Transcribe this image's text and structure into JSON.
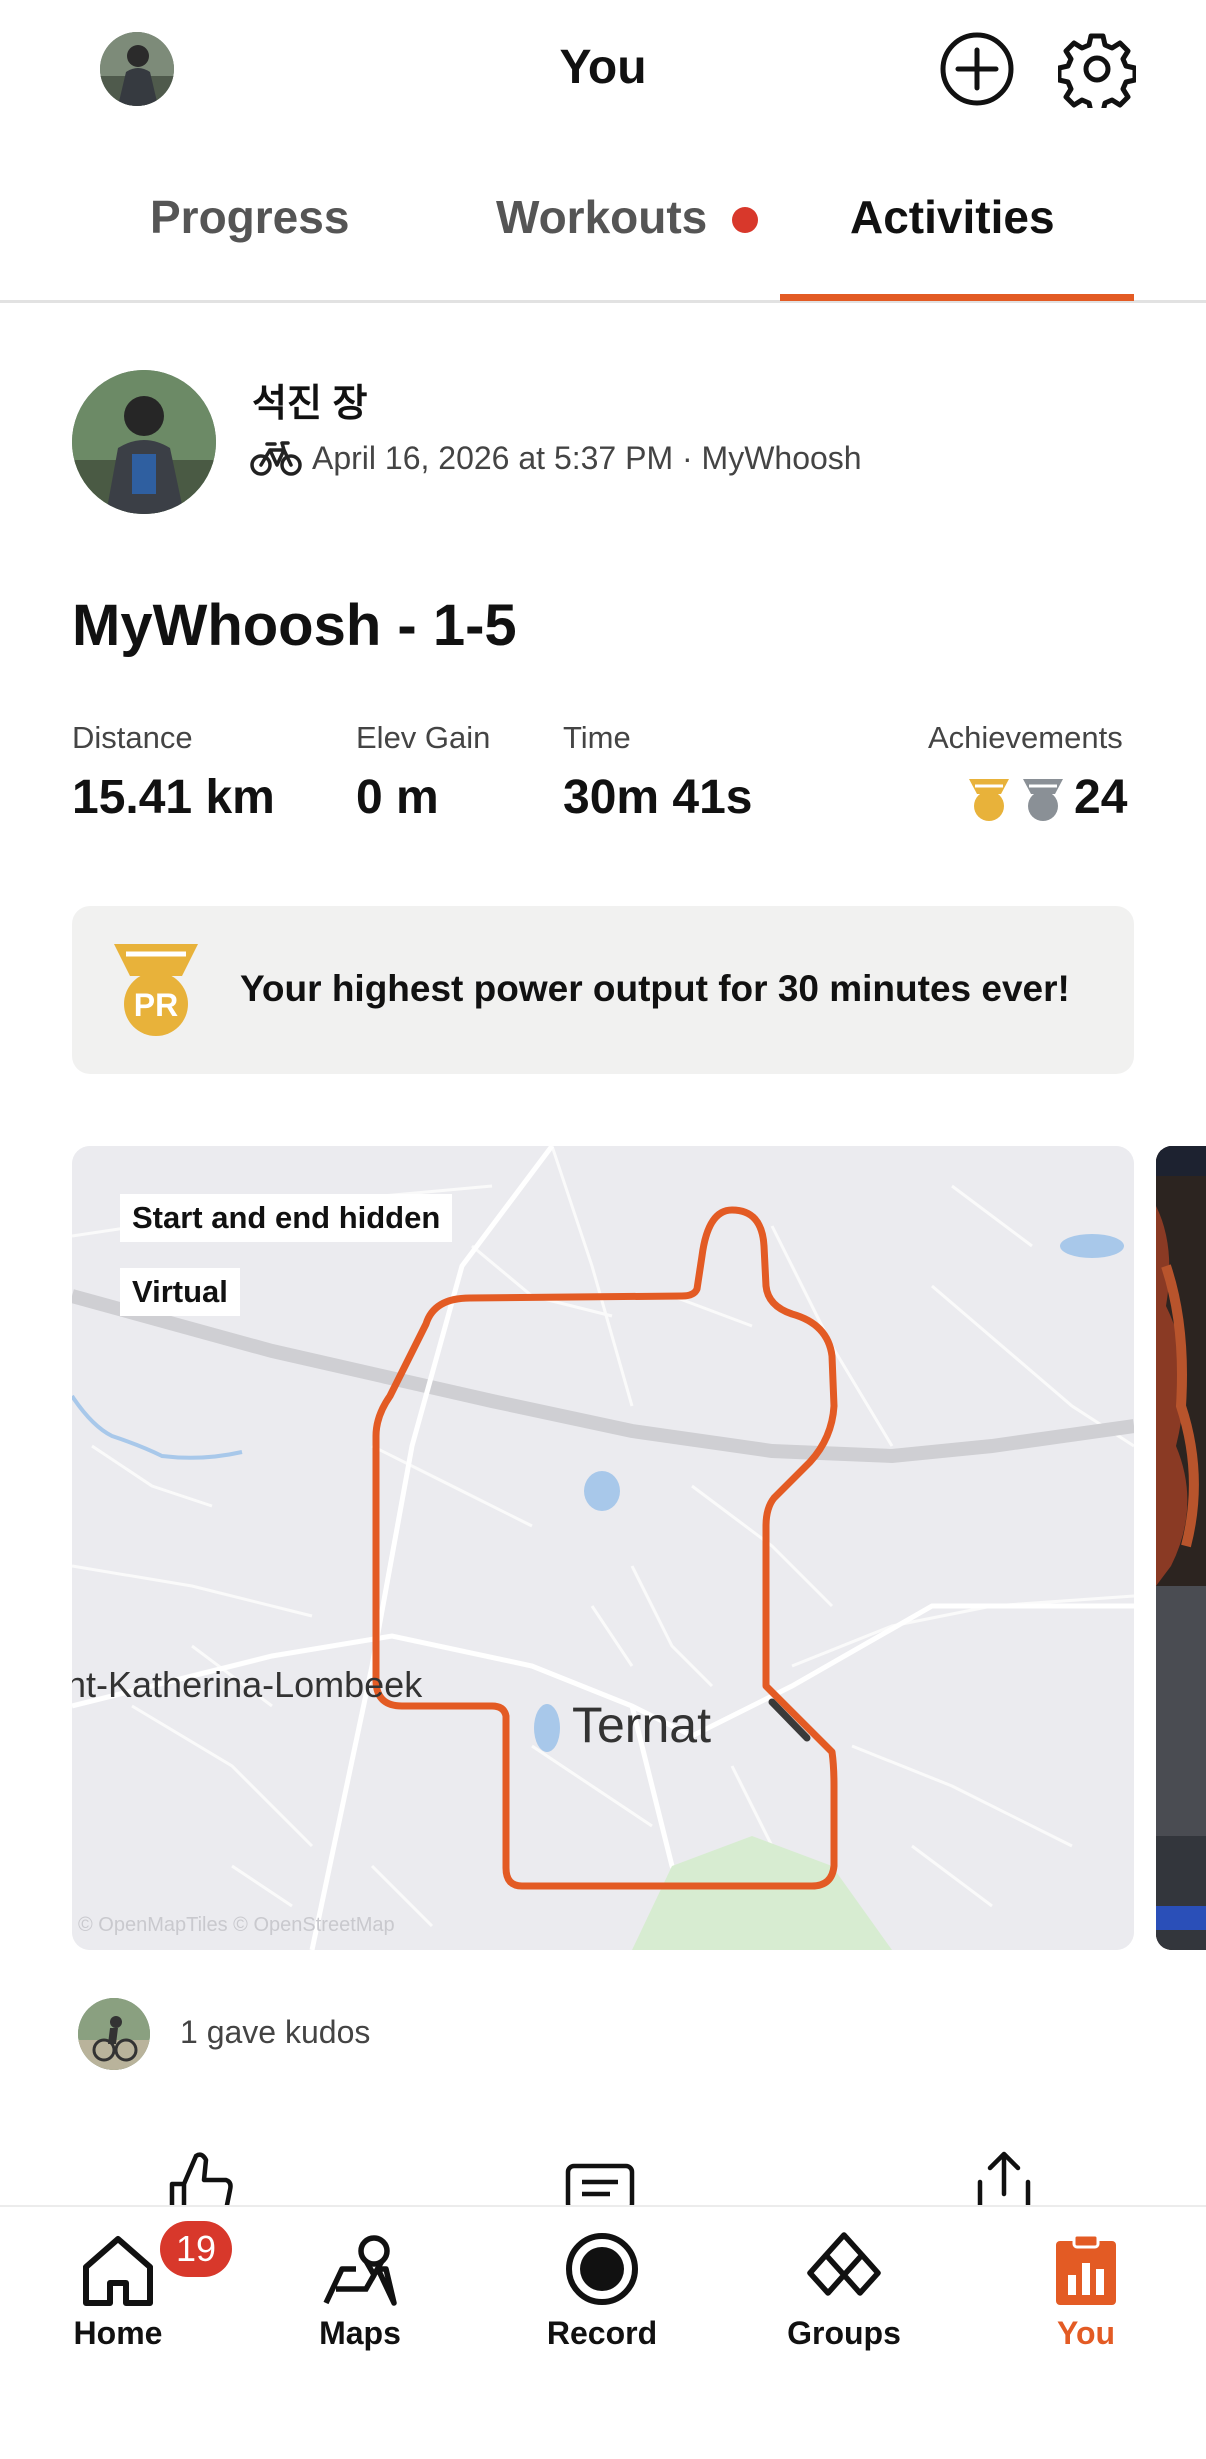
{
  "header": {
    "title": "You",
    "add_icon": "plus-circle-icon",
    "settings_icon": "gear-icon"
  },
  "tabs": [
    {
      "label": "Progress",
      "active": false
    },
    {
      "label": "Workouts",
      "active": false,
      "has_dot": true
    },
    {
      "label": "Activities",
      "active": true
    }
  ],
  "activity": {
    "athlete": "석진 장",
    "meta": "April 16, 2026 at 5:37 PM · MyWhoosh",
    "sport_icon": "bike-icon",
    "title": "MyWhoosh - 1-5",
    "stats": [
      {
        "label": "Distance",
        "value": "15.41 km"
      },
      {
        "label": "Elev Gain",
        "value": "0 m"
      },
      {
        "label": "Time",
        "value": "30m 41s"
      },
      {
        "label": "Achievements",
        "value": "24"
      }
    ],
    "pr_badge": "PR",
    "pr_text": "Your highest power output for 30 minutes ever!"
  },
  "map": {
    "tag_hidden": "Start and end hidden",
    "tag_virtual": "Virtual",
    "place_main": "Ternat",
    "place_secondary": "nt-Katherina-Lombeek",
    "attribution": "© OpenMapTiles © OpenStreetMap",
    "route_color": "#e35b24"
  },
  "kudos": {
    "text": "1 gave kudos"
  },
  "actions": [
    "thumbs-up-icon",
    "comment-icon",
    "share-icon"
  ],
  "nav": {
    "items": [
      {
        "label": "Home",
        "icon": "home-icon",
        "badge": "19",
        "active": false
      },
      {
        "label": "Maps",
        "icon": "maps-icon",
        "active": false
      },
      {
        "label": "Record",
        "icon": "record-icon",
        "active": false
      },
      {
        "label": "Groups",
        "icon": "groups-icon",
        "active": false
      },
      {
        "label": "You",
        "icon": "you-icon",
        "active": true
      }
    ]
  },
  "colors": {
    "accent": "#e35b24",
    "badge": "#d8382b",
    "gold": "#e8b23a",
    "silver": "#8a9096"
  }
}
